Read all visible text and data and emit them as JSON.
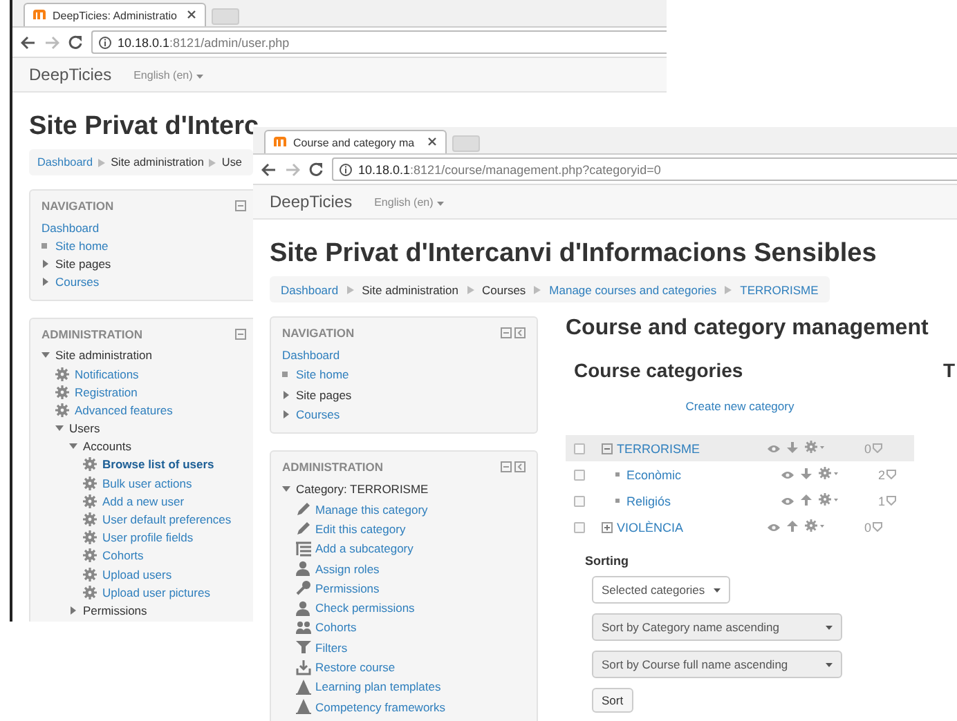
{
  "back_window": {
    "tab_title": "DeepTicies: Administratio",
    "url_host": "10.18.0.1",
    "url_rest": ":8121/admin/user.php",
    "brand": "DeepTicies",
    "language": "English (en)",
    "site_title": "Site Privat d'Interc",
    "breadcrumb": [
      {
        "label": "Dashboard",
        "link": true
      },
      {
        "label": "Site administration",
        "link": false
      },
      {
        "label": "Use",
        "link": false
      }
    ],
    "navigation": {
      "title": "NAVIGATION",
      "items": [
        {
          "label": "Dashboard",
          "kind": "plain",
          "link": true
        },
        {
          "label": "Site home",
          "kind": "leaf",
          "link": true
        },
        {
          "label": "Site pages",
          "kind": "branch",
          "expanded": false,
          "link": false
        },
        {
          "label": "Courses",
          "kind": "branch",
          "expanded": false,
          "link": true
        }
      ]
    },
    "administration": {
      "title": "ADMINISTRATION",
      "items": [
        {
          "label": "Site administration",
          "kind": "branch",
          "expanded": true,
          "link": false,
          "children": [
            {
              "label": "Notifications",
              "kind": "gear",
              "link": true,
              "selected": false
            },
            {
              "label": "Registration",
              "kind": "gear",
              "link": true,
              "selected": false
            },
            {
              "label": "Advanced features",
              "kind": "gear",
              "link": true,
              "selected": false
            },
            {
              "label": "Users",
              "kind": "branch",
              "expanded": true,
              "link": false,
              "children": [
                {
                  "label": "Accounts",
                  "kind": "branch",
                  "expanded": true,
                  "link": false,
                  "children": [
                    {
                      "label": "Browse list of users",
                      "kind": "gear",
                      "link": true,
                      "selected": true
                    },
                    {
                      "label": "Bulk user actions",
                      "kind": "gear",
                      "link": true,
                      "selected": false
                    },
                    {
                      "label": "Add a new user",
                      "kind": "gear",
                      "link": true,
                      "selected": false
                    },
                    {
                      "label": "User default preferences",
                      "kind": "gear",
                      "link": true,
                      "selected": false
                    },
                    {
                      "label": "User profile fields",
                      "kind": "gear",
                      "link": true,
                      "selected": false
                    },
                    {
                      "label": "Cohorts",
                      "kind": "gear",
                      "link": true,
                      "selected": false
                    },
                    {
                      "label": "Upload users",
                      "kind": "gear",
                      "link": true,
                      "selected": false
                    },
                    {
                      "label": "Upload user pictures",
                      "kind": "gear",
                      "link": true,
                      "selected": false
                    }
                  ]
                },
                {
                  "label": "Permissions",
                  "kind": "branch",
                  "expanded": false,
                  "link": false
                }
              ]
            }
          ]
        }
      ]
    }
  },
  "front_window": {
    "tab_title": "Course and category ma",
    "url_host": "10.18.0.1",
    "url_rest": ":8121/course/management.php?categoryid=0",
    "brand": "DeepTicies",
    "language": "English (en)",
    "site_title": "Site Privat d'Intercanvi d'Informacions Sensibles",
    "breadcrumb": [
      {
        "label": "Dashboard",
        "link": true
      },
      {
        "label": "Site administration",
        "link": false
      },
      {
        "label": "Courses",
        "link": false
      },
      {
        "label": "Manage courses and categories",
        "link": true
      },
      {
        "label": "TERRORISME",
        "link": true
      }
    ],
    "navigation": {
      "title": "NAVIGATION",
      "items": [
        {
          "label": "Dashboard",
          "kind": "plain",
          "link": true
        },
        {
          "label": "Site home",
          "kind": "leaf",
          "link": true
        },
        {
          "label": "Site pages",
          "kind": "branch",
          "expanded": false,
          "link": false
        },
        {
          "label": "Courses",
          "kind": "branch",
          "expanded": false,
          "link": true
        }
      ]
    },
    "administration": {
      "title": "ADMINISTRATION",
      "items": [
        {
          "label": "Category: TERRORISME",
          "kind": "branch",
          "expanded": true,
          "link": false,
          "children": [
            {
              "label": "Manage this category",
              "kind": "pencil",
              "link": true
            },
            {
              "label": "Edit this category",
              "kind": "pencil",
              "link": true
            },
            {
              "label": "Add a subcategory",
              "kind": "list",
              "link": true
            },
            {
              "label": "Assign roles",
              "kind": "person",
              "link": true
            },
            {
              "label": "Permissions",
              "kind": "key",
              "link": true
            },
            {
              "label": "Check permissions",
              "kind": "person",
              "link": true
            },
            {
              "label": "Cohorts",
              "kind": "people",
              "link": true
            },
            {
              "label": "Filters",
              "kind": "funnel",
              "link": true
            },
            {
              "label": "Restore course",
              "kind": "tray",
              "link": true
            },
            {
              "label": "Learning plan templates",
              "kind": "pyramid",
              "link": true
            },
            {
              "label": "Competency frameworks",
              "kind": "pyramid",
              "link": true
            }
          ]
        }
      ]
    },
    "main": {
      "heading": "Course and category management",
      "categories_heading": "Course categories",
      "next_heading": "T",
      "create_link": "Create new category",
      "categories": [
        {
          "name": "TERRORISME",
          "selected": true,
          "checked": false,
          "expanded": true,
          "move_up": false,
          "count": "0",
          "children": [
            {
              "name": "Econòmic",
              "selected": false,
              "checked": false,
              "move_up": false,
              "count": "2"
            },
            {
              "name": "Religiós",
              "selected": false,
              "checked": false,
              "move_up": true,
              "count": "1"
            }
          ]
        },
        {
          "name": "VIOLÈNCIA",
          "selected": false,
          "checked": false,
          "expanded": false,
          "move_up": true,
          "count": "0"
        }
      ],
      "sorting_label": "Sorting",
      "scope_select": "Selected categories",
      "category_sort": "Sort by Category name ascending",
      "course_sort": "Sort by Course full name ascending",
      "sort_button": "Sort"
    }
  }
}
